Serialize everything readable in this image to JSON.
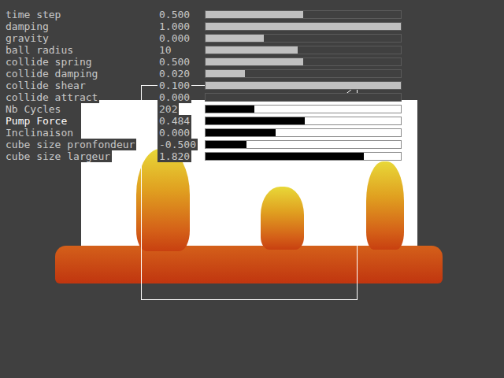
{
  "panel": {
    "rows": [
      {
        "label": "time step",
        "value": "0.500",
        "level": 0.5,
        "kind": "dim",
        "selected": false
      },
      {
        "label": "damping",
        "value": "1.000",
        "level": 1.0,
        "kind": "dim",
        "selected": false
      },
      {
        "label": "gravity",
        "value": "0.000",
        "level": 0.3,
        "kind": "dim",
        "selected": false
      },
      {
        "label": "ball radius",
        "value": "10",
        "level": 0.47,
        "kind": "dim",
        "selected": false
      },
      {
        "label": "collide spring",
        "value": "0.500",
        "level": 0.5,
        "kind": "dim",
        "selected": false
      },
      {
        "label": "collide damping",
        "value": "0.020",
        "level": 0.2,
        "kind": "dim",
        "selected": false
      },
      {
        "label": "collide shear",
        "value": "0.100",
        "level": 1.0,
        "kind": "dim",
        "selected": false
      },
      {
        "label": "collide attract",
        "value": "0.000",
        "level": 0.0,
        "kind": "dim",
        "selected": false
      },
      {
        "label": "Nb Cycles",
        "value": "202",
        "level": 0.25,
        "kind": "active",
        "selected": false
      },
      {
        "label": "Pump Force",
        "value": "0.484",
        "level": 0.51,
        "kind": "active",
        "selected": true
      },
      {
        "label": "Inclinaison",
        "value": "0.000",
        "level": 0.36,
        "kind": "active",
        "selected": false
      },
      {
        "label": "cube size pronfondeur",
        "value": "-0.500",
        "level": 0.21,
        "kind": "active",
        "selected": false
      },
      {
        "label": "cube size largeur",
        "value": "1.820",
        "level": 0.81,
        "kind": "active",
        "selected": false
      }
    ]
  }
}
